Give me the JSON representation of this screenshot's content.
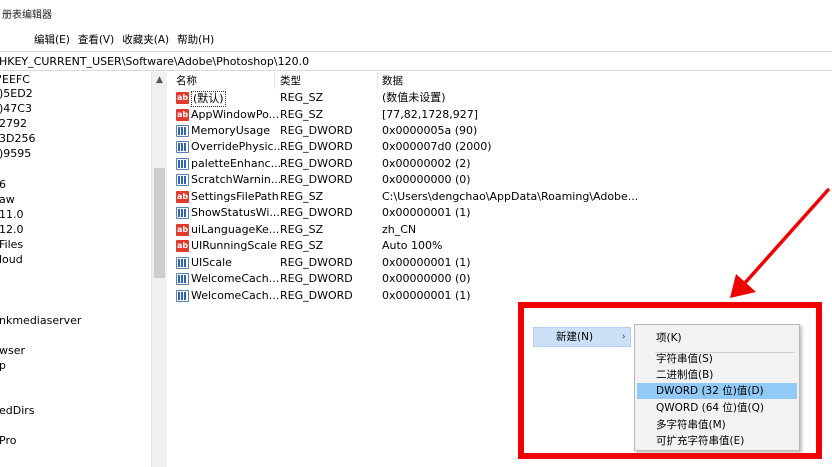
{
  "window": {
    "title": "册表编辑器"
  },
  "menubar": {
    "items": [
      "编辑(E)",
      "查看(V)",
      "收藏夹(A)",
      "帮助(H)"
    ]
  },
  "address": {
    "path": "HKEY_CURRENT_USER\\Software\\Adobe\\Photoshop\\120.0"
  },
  "tree": {
    "items": [
      "'EEFC",
      ")5ED2",
      ")47C3",
      "2792",
      "3D256",
      ")9595",
      "6",
      "aw",
      "11.0",
      "12.0",
      "Files",
      "loud",
      "nkmediaserver",
      "wser",
      "p",
      "edDirs",
      "Pro"
    ]
  },
  "values": {
    "columns": {
      "name": "名称",
      "type": "类型",
      "data": "数据"
    },
    "rows": [
      {
        "icon": "string-value-icon",
        "name": "(默认)",
        "type": "REG_SZ",
        "data": "(数值未设置)"
      },
      {
        "icon": "string-value-icon",
        "name": "AppWindowPo...",
        "type": "REG_SZ",
        "data": "[77,82,1728,927]"
      },
      {
        "icon": "dword-value-icon",
        "name": "MemoryUsage",
        "type": "REG_DWORD",
        "data": "0x0000005a (90)"
      },
      {
        "icon": "dword-value-icon",
        "name": "OverridePhysic...",
        "type": "REG_DWORD",
        "data": "0x000007d0 (2000)"
      },
      {
        "icon": "dword-value-icon",
        "name": "paletteEnhanc...",
        "type": "REG_DWORD",
        "data": "0x00000002 (2)"
      },
      {
        "icon": "dword-value-icon",
        "name": "ScratchWarnin...",
        "type": "REG_DWORD",
        "data": "0x00000000 (0)"
      },
      {
        "icon": "string-value-icon",
        "name": "SettingsFilePath",
        "type": "REG_SZ",
        "data": "C:\\Users\\dengchao\\AppData\\Roaming\\Adobe..."
      },
      {
        "icon": "dword-value-icon",
        "name": "ShowStatusWi...",
        "type": "REG_DWORD",
        "data": "0x00000001 (1)"
      },
      {
        "icon": "string-value-icon",
        "name": "uiLanguageKe...",
        "type": "REG_SZ",
        "data": "zh_CN"
      },
      {
        "icon": "string-value-icon",
        "name": "UIRunningScale",
        "type": "REG_SZ",
        "data": "Auto 100%"
      },
      {
        "icon": "dword-value-icon",
        "name": "UIScale",
        "type": "REG_DWORD",
        "data": "0x00000001 (1)"
      },
      {
        "icon": "dword-value-icon",
        "name": "WelcomeCach...",
        "type": "REG_DWORD",
        "data": "0x00000000 (0)"
      },
      {
        "icon": "dword-value-icon",
        "name": "WelcomeCach...",
        "type": "REG_DWORD",
        "data": "0x00000001 (1)"
      }
    ],
    "string_icon_glyph": "ab"
  },
  "context_menu": {
    "new_label": "新建(N)",
    "arrow": "›"
  },
  "submenu": {
    "items": [
      "项(K)",
      "字符串值(S)",
      "二进制值(B)",
      "DWORD (32 位)值(D)",
      "QWORD (64 位)值(Q)",
      "多字符串值(M)",
      "可扩充字符串值(E)"
    ]
  },
  "annotation": {
    "color": "#f20000"
  },
  "colors": {
    "menu_highlight": "#cce0f7",
    "submenu_hover": "#91c9f7",
    "string_icon": "#e33a2d",
    "dword_icon": "#2f62b0"
  }
}
